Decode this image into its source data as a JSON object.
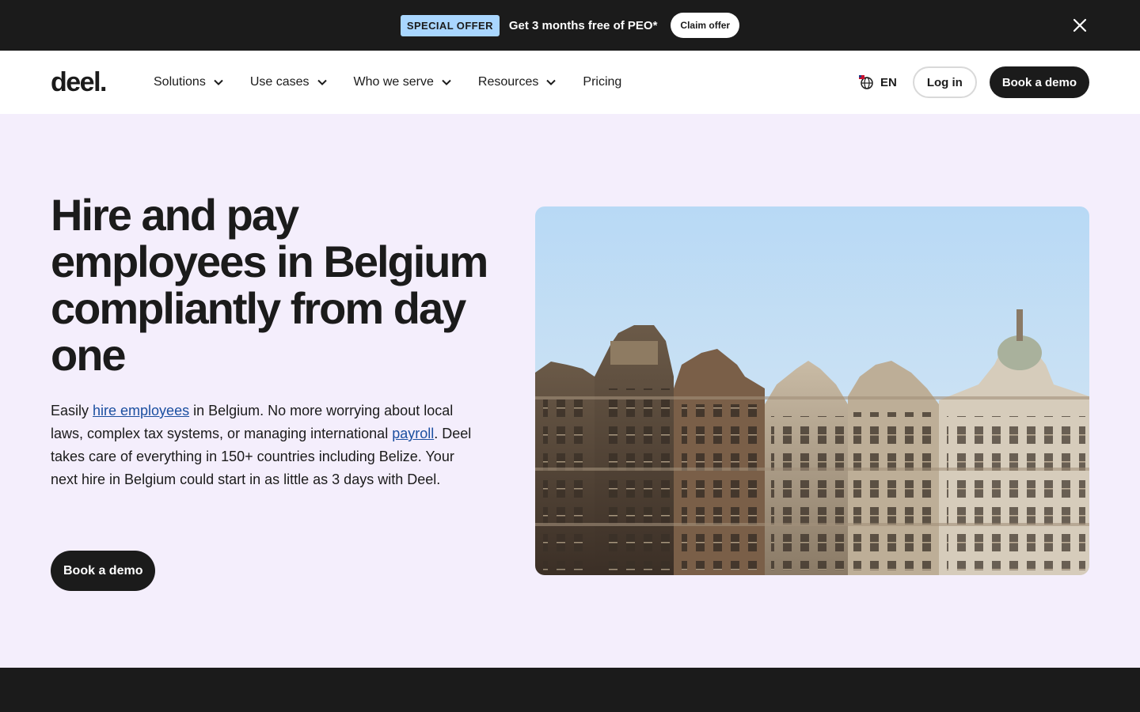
{
  "promo": {
    "badge": "SPECIAL OFFER",
    "text": "Get 3 months free of PEO*",
    "button": "Claim offer"
  },
  "nav": {
    "logo": "deel.",
    "items": [
      {
        "label": "Solutions",
        "dropdown": true
      },
      {
        "label": "Use cases",
        "dropdown": true
      },
      {
        "label": "Who we serve",
        "dropdown": true
      },
      {
        "label": "Resources",
        "dropdown": true
      },
      {
        "label": "Pricing",
        "dropdown": false
      }
    ],
    "language": "EN",
    "login": "Log in",
    "demo": "Book a demo"
  },
  "hero": {
    "title": "Hire and pay employees in Belgium compliantly from day one",
    "desc_1": "Easily ",
    "link_hire": "hire employees",
    "desc_2": " in Belgium. No more worrying about local laws, complex tax systems, or managing international ",
    "link_payroll": "payroll",
    "desc_3": ". Deel takes care of everything in 150+ countries including Belize. Your next hire in Belgium could start in as little as 3 days with Deel.",
    "cta": "Book a demo"
  },
  "colors": {
    "dark": "#1b1b1b",
    "hero_bg": "#f4eefc",
    "badge": "#a9d6ff",
    "link": "#1b4fa0"
  }
}
